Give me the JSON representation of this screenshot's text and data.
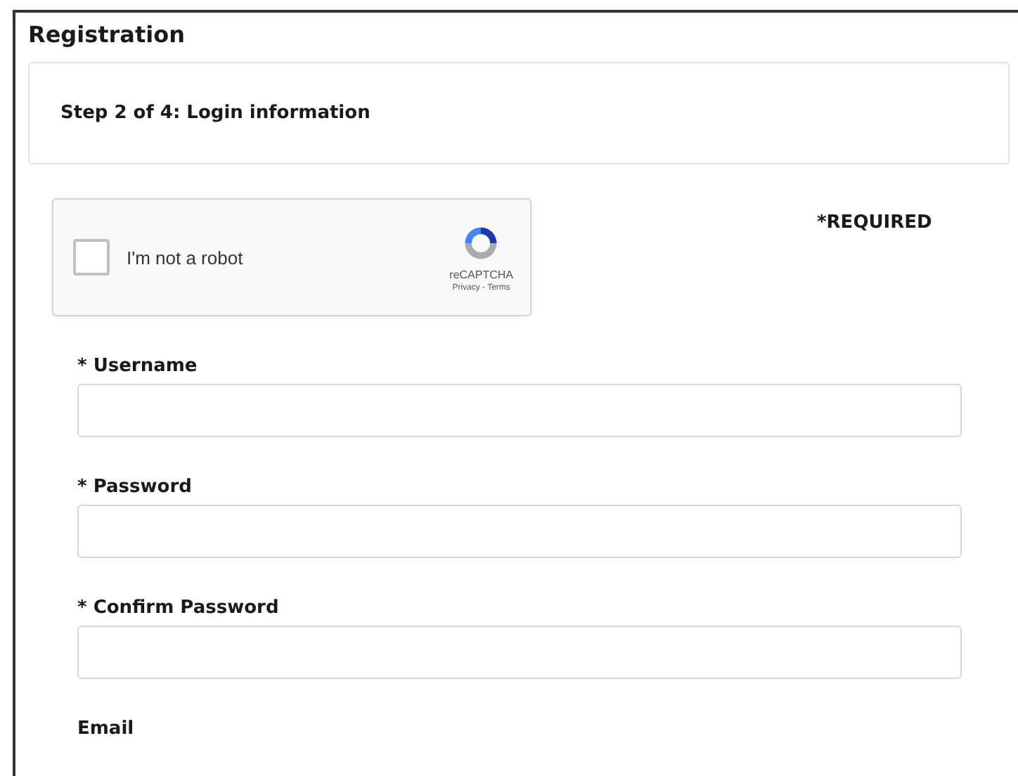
{
  "page": {
    "title": "Registration"
  },
  "step": {
    "label": "Step 2 of 4: Login information"
  },
  "captcha": {
    "checked": false,
    "label": "I'm not a robot",
    "brand": "reCAPTCHA",
    "links": "Privacy - Terms"
  },
  "required_note": "*REQUIRED",
  "fields": [
    {
      "label": "* Username",
      "kind": "input"
    },
    {
      "label": "* Password",
      "kind": "input"
    },
    {
      "label": "* Confirm Password",
      "kind": "input"
    },
    {
      "label": "Email",
      "kind": "label_only"
    }
  ]
}
